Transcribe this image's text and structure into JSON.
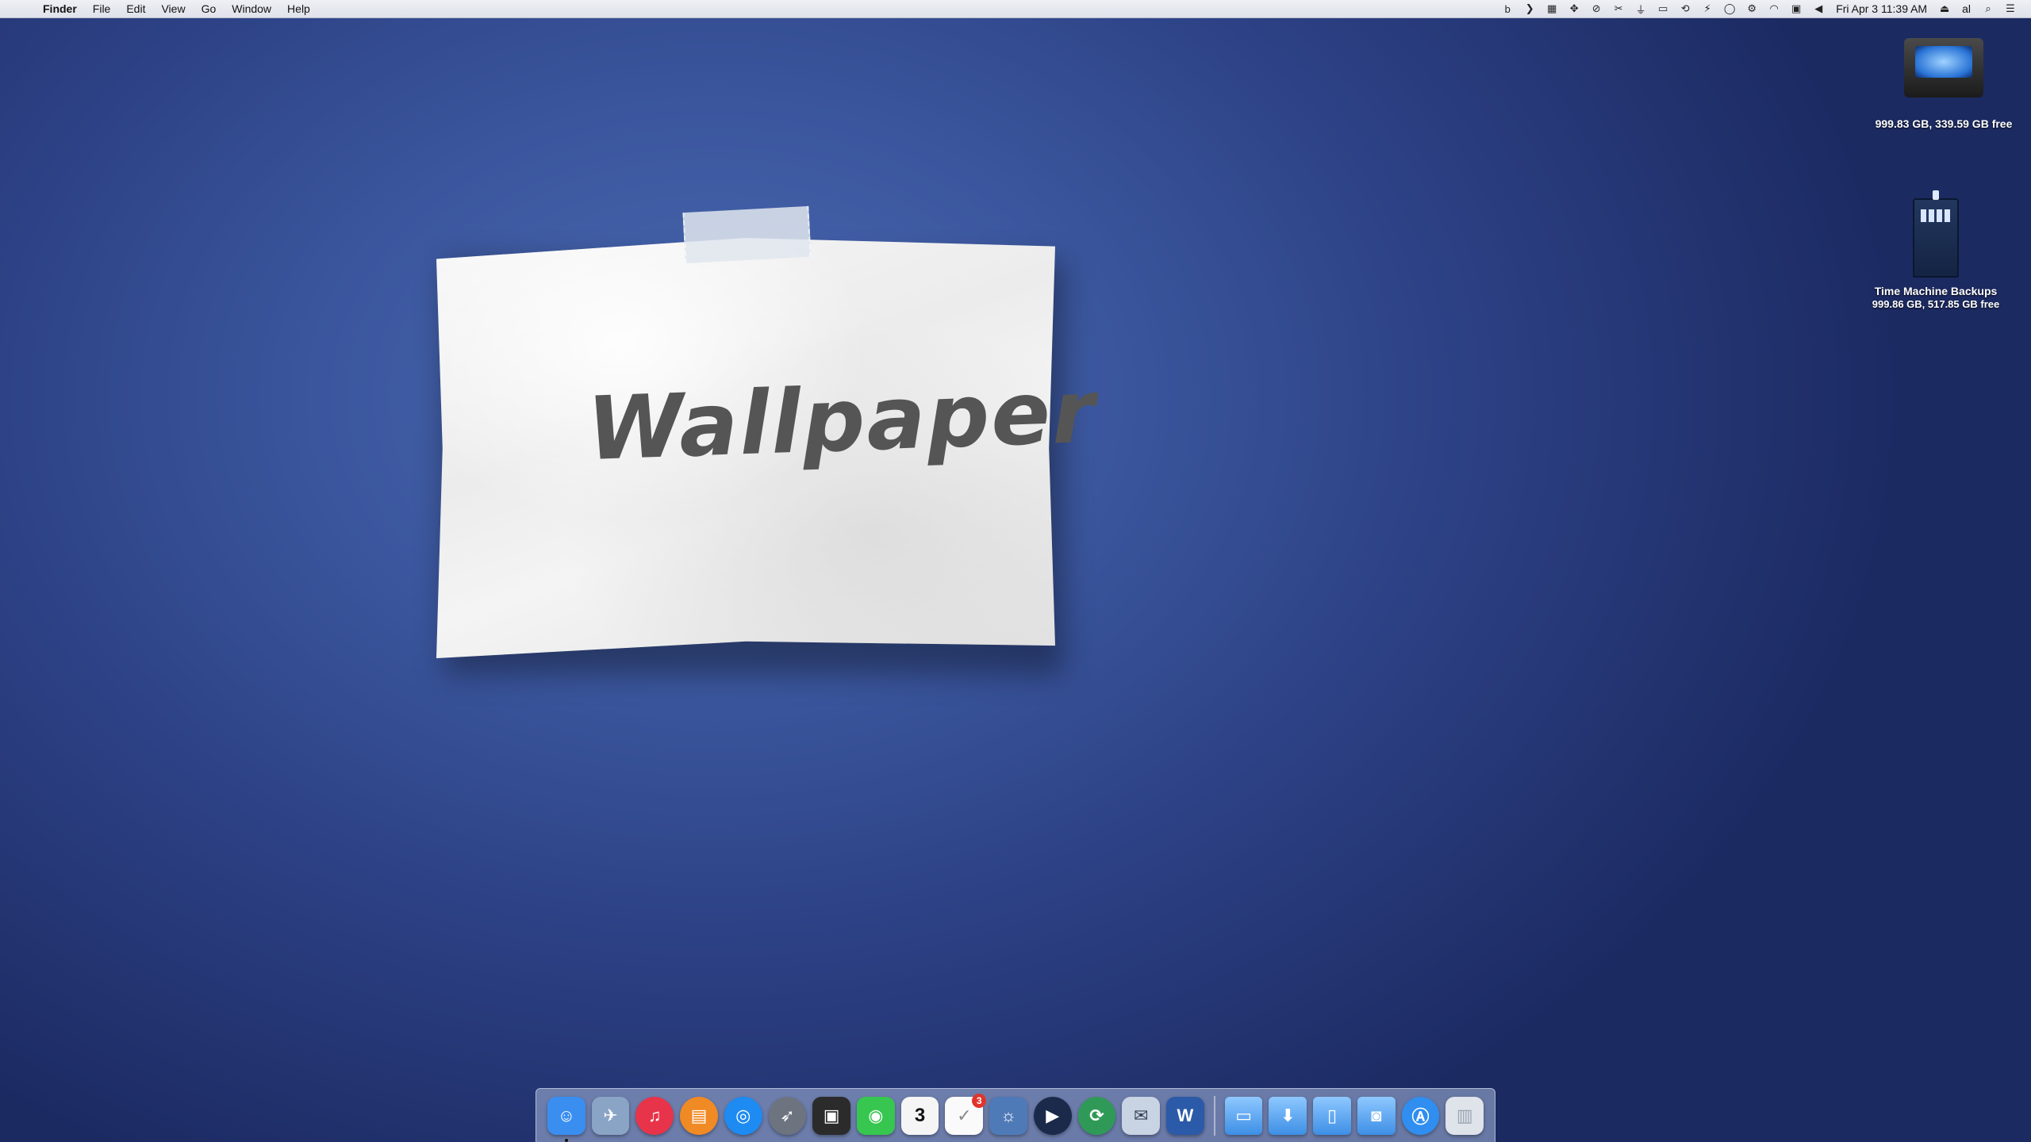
{
  "menubar": {
    "apple_symbol": "",
    "items": [
      "Finder",
      "File",
      "Edit",
      "View",
      "Go",
      "Window",
      "Help"
    ],
    "status_icons": [
      "b",
      "❯",
      "▦",
      "✥",
      "⊘",
      "✂",
      "⏚",
      "▭",
      "⟲",
      "⚡",
      "◯",
      "⚙",
      "◠",
      "▣",
      "◀"
    ],
    "clock": "Fri Apr 3  11:39 AM",
    "eject": "⏏",
    "user": "al",
    "search": "⌕",
    "list": "☰"
  },
  "wallpaper": {
    "text": "Wallpaper"
  },
  "desktop": {
    "drive": {
      "label": "999.83 GB, 339.59 GB free"
    },
    "time_machine": {
      "name": "Time Machine Backups",
      "info": "999.86 GB, 517.85 GB free"
    }
  },
  "dock": {
    "apps": [
      {
        "name": "Finder",
        "glyph": "☺",
        "color": "#3a8ef0"
      },
      {
        "name": "Preview",
        "glyph": "✈",
        "color": "#8aa4c6"
      },
      {
        "name": "iTunes",
        "glyph": "♫",
        "color": "#e8344a"
      },
      {
        "name": "iBooks",
        "glyph": "▤",
        "color": "#f08a24"
      },
      {
        "name": "Safari",
        "glyph": "◎",
        "color": "#1d8bf2"
      },
      {
        "name": "Launchpad",
        "glyph": "➶",
        "color": "#6d7480"
      },
      {
        "name": "Photo Booth",
        "glyph": "▣",
        "color": "#2b2b2b"
      },
      {
        "name": "FaceTime",
        "glyph": "◉",
        "color": "#37c64f"
      },
      {
        "name": "Calendar",
        "glyph": "3",
        "color": "#f5f5f5"
      },
      {
        "name": "Reminders",
        "glyph": "✓",
        "color": "#fafafa",
        "badge": "3"
      },
      {
        "name": "iPhoto",
        "glyph": "☼",
        "color": "#4f7ab8"
      },
      {
        "name": "Final Cut Pro",
        "glyph": "▶",
        "color": "#1b2a4a"
      },
      {
        "name": "Sync",
        "glyph": "⟳",
        "color": "#2f9a57"
      },
      {
        "name": "Mail",
        "glyph": "✉",
        "color": "#c8d3e3"
      },
      {
        "name": "Word",
        "glyph": "W",
        "color": "#2b5aa8"
      }
    ],
    "right": [
      {
        "name": "Applications folder",
        "glyph": "▭"
      },
      {
        "name": "Downloads folder",
        "glyph": "⬇"
      },
      {
        "name": "Documents folder",
        "glyph": "▯"
      },
      {
        "name": "Screenshots folder",
        "glyph": "◙"
      },
      {
        "name": "App Store",
        "glyph": "Ⓐ",
        "color": "#2f8ef0"
      },
      {
        "name": "Trash",
        "glyph": "▥",
        "color": "#dfe3ea"
      }
    ]
  }
}
